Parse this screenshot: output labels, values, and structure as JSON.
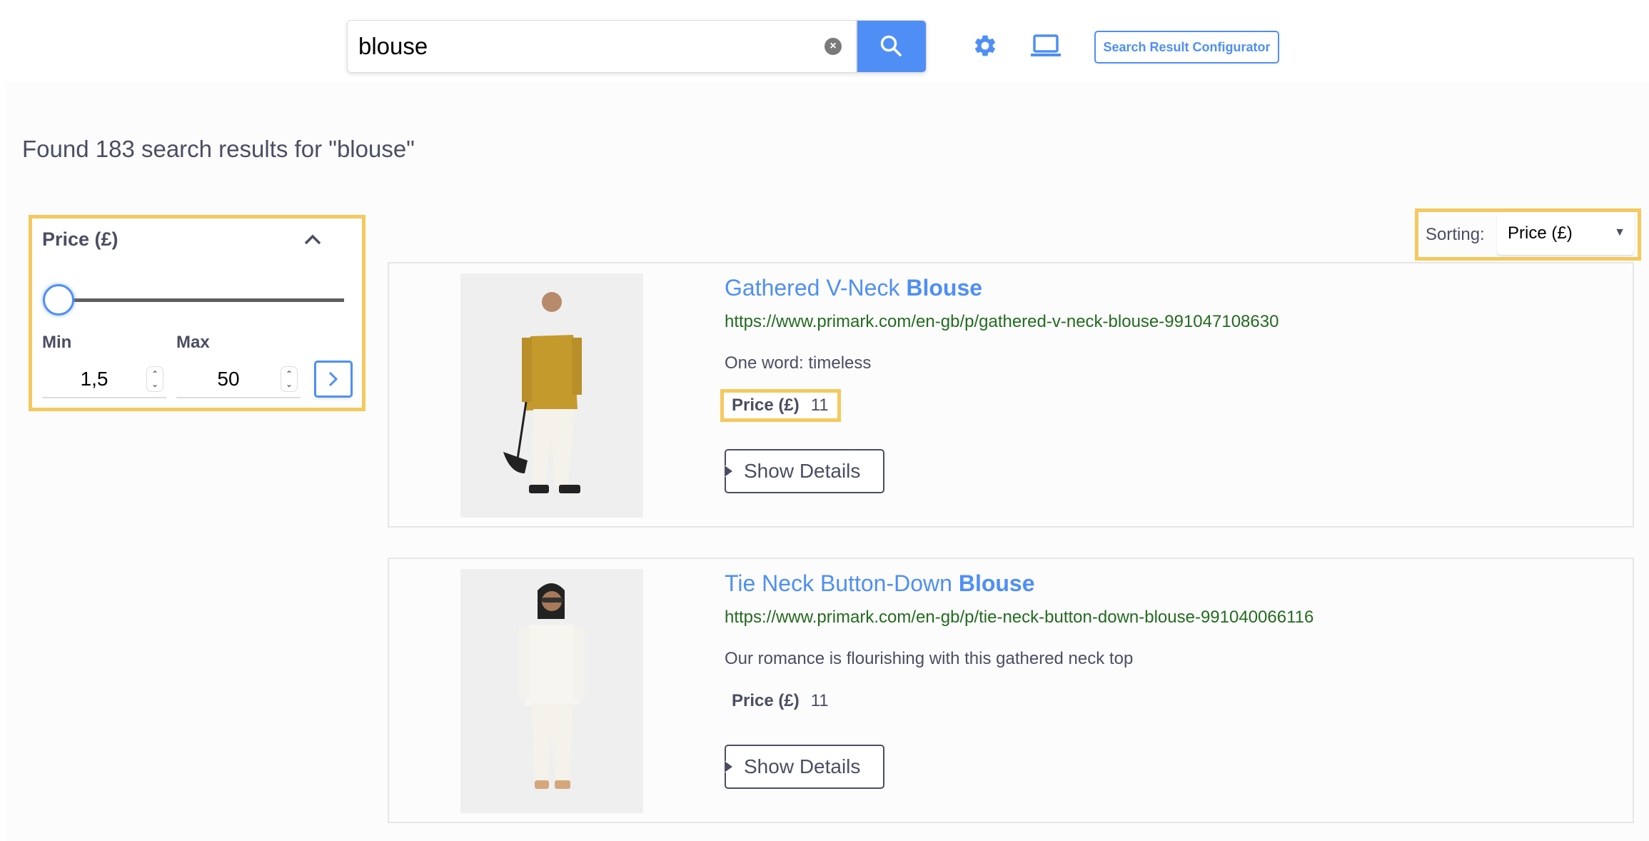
{
  "header": {
    "search_value": "blouse",
    "search_icon": "search-icon",
    "clear_icon": "clear-icon",
    "settings_icon": "gear-icon",
    "device_icon": "laptop-icon",
    "configurator_label": "Search Result Configurator",
    "accent_color": "#4f8ff5"
  },
  "summary": {
    "text": "Found 183 search results for \"blouse\""
  },
  "facet": {
    "title": "Price (£)",
    "collapse_icon": "chevron-up-icon",
    "min_label": "Min",
    "max_label": "Max",
    "min_value": "1,5",
    "max_value": "50",
    "slider_min_position": 0,
    "apply_icon": "chevron-right-icon"
  },
  "sorting": {
    "label": "Sorting:",
    "selected": "Price (£)"
  },
  "results": [
    {
      "title_prefix": "Gathered V-Neck ",
      "title_match": "Blouse",
      "url": "https://www.primark.com/en-gb/p/gathered-v-neck-blouse-991047108630",
      "description": "One word: timeless",
      "price_label": "Price (£)",
      "price_value": "11",
      "details_label": "Show Details",
      "image_alt": "Model wearing mustard v-neck blouse with white trousers"
    },
    {
      "title_prefix": "Tie Neck Button-Down ",
      "title_match": "Blouse",
      "url": "https://www.primark.com/en-gb/p/tie-neck-button-down-blouse-991040066116",
      "description": "Our romance is flourishing with this gathered neck top",
      "price_label": "Price (£)",
      "price_value": "11",
      "details_label": "Show Details",
      "image_alt": "Model wearing white tie neck blouse with white trousers"
    }
  ]
}
